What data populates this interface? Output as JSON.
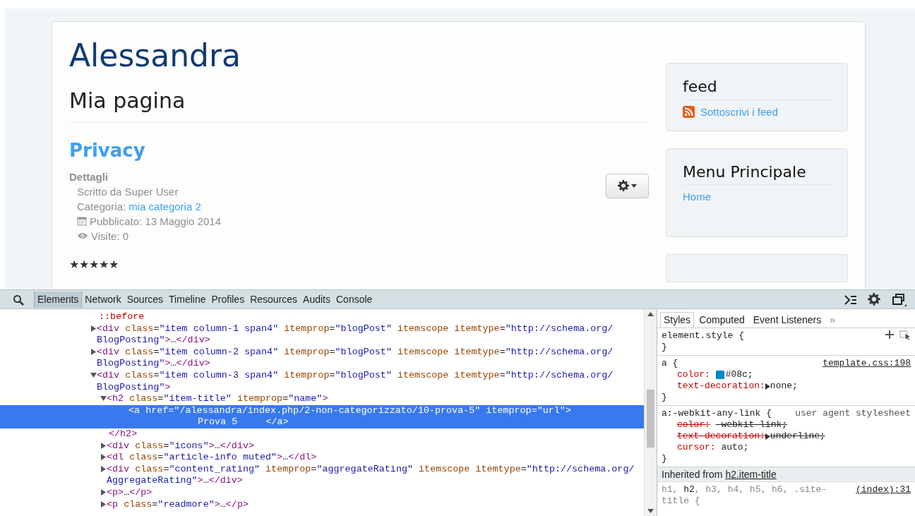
{
  "site": {
    "title": "Alessandra"
  },
  "page": {
    "heading": "Mia pagina",
    "article_title": "Privacy",
    "details_label": "Dettagli",
    "info": [
      {
        "kind": "author",
        "text": "Scritto da Super User"
      },
      {
        "kind": "category",
        "text": "Categoria:",
        "link": "mia categoria 2"
      },
      {
        "kind": "published",
        "text": "Pubblicato: 13 Maggio 2014"
      },
      {
        "kind": "hits",
        "text": "Visite: 0"
      }
    ],
    "rating": {
      "stars": 5
    }
  },
  "sidebar": {
    "modules": [
      {
        "title": "feed",
        "links": [
          {
            "kind": "rss",
            "text": "Sottoscrivi i feed"
          }
        ]
      },
      {
        "title": "Menu Principale",
        "links": [
          {
            "kind": "plain",
            "text": "Home"
          }
        ]
      }
    ]
  },
  "devtools": {
    "tabs": [
      {
        "label": "Elements",
        "selected": true
      },
      {
        "label": "Network",
        "selected": false
      },
      {
        "label": "Sources",
        "selected": false
      },
      {
        "label": "Timeline",
        "selected": false
      },
      {
        "label": "Profiles",
        "selected": false
      },
      {
        "label": "Resources",
        "selected": false
      },
      {
        "label": "Audits",
        "selected": false
      },
      {
        "label": "Console",
        "selected": false
      }
    ],
    "dom": [
      {
        "kind": "pseudo",
        "markup": "::before"
      },
      {
        "kind": "element",
        "expanded": false,
        "markup": "<div class=\"item column-1 span4\" itemprop=\"blogPost\" itemscope itemtype=\"http://schema.org/BlogPosting\">…</div>"
      },
      {
        "kind": "element",
        "expanded": false,
        "markup": "<div class=\"item column-2 span4\" itemprop=\"blogPost\" itemscope itemtype=\"http://schema.org/BlogPosting\">…</div>"
      },
      {
        "kind": "element",
        "expanded": true,
        "markup": "<div class=\"item column-3 span4\" itemprop=\"blogPost\" itemscope itemtype=\"http://schema.org/BlogPosting\">",
        "children": [
          {
            "kind": "element",
            "expanded": true,
            "markup": "<h2 class=\"item-title\" itemprop=\"name\">",
            "close": "</h2>",
            "children": [
              {
                "kind": "leaf",
                "selected": true,
                "markup": "<a href=\"/alessandra/index.php/2-non-categorizzato/10-prova-5\" itemprop=\"url\">",
                "content": "Prova 5",
                "close": "</a>"
              }
            ]
          },
          {
            "kind": "element",
            "expanded": false,
            "markup": "<div class=\"icons\">…</div>"
          },
          {
            "kind": "element",
            "expanded": false,
            "markup": "<dl class=\"article-info  muted\">…</dl>"
          },
          {
            "kind": "element",
            "expanded": false,
            "markup": "<div class=\"content_rating\" itemprop=\"aggregateRating\" itemscope itemtype=\"http://schema.org/AggregateRating\">…</div>"
          },
          {
            "kind": "element",
            "expanded": false,
            "markup": "<p>…</p>"
          },
          {
            "kind": "element",
            "expanded": false,
            "markup": "<p class=\"readmore\">…</p>"
          }
        ]
      }
    ],
    "style_tabs": [
      {
        "label": "Styles",
        "selected": true
      },
      {
        "label": "Computed",
        "selected": false
      },
      {
        "label": "Event Listeners",
        "selected": false
      }
    ],
    "more_tabs": "»",
    "rules": [
      {
        "kind": "inline",
        "selector": "element.style {",
        "close": "}"
      },
      {
        "kind": "author",
        "selector": "a {",
        "source": "template.css:198",
        "props": [
          {
            "kind": "color",
            "name": "color:",
            "value": "#08c;",
            "overridden": false
          },
          {
            "kind": "keyword",
            "name": "text-decoration:",
            "value": "none;",
            "overridden": false
          }
        ],
        "close": "}"
      },
      {
        "kind": "user-agent",
        "selector": "a:-webkit-any-link {",
        "source": "user agent stylesheet",
        "props": [
          {
            "kind": "plain",
            "name": "color:",
            "value": "-webkit-link;",
            "overridden": true
          },
          {
            "kind": "keyword",
            "name": "text-decoration:",
            "value": "underline;",
            "overridden": true
          },
          {
            "kind": "plain",
            "name": "cursor:",
            "value": "auto;",
            "overridden": false
          }
        ],
        "close": "}"
      }
    ],
    "inherited": {
      "label": "Inherited from",
      "link": "h2.item-title"
    },
    "inherited_rule": {
      "selector": [
        {
          "text": "h1, ",
          "matched": false
        },
        {
          "text": "h2",
          "matched": true
        },
        {
          "text": ", h3, h4, h5, h6, .site-title {",
          "matched": false
        }
      ],
      "source": "(index):31"
    }
  }
}
